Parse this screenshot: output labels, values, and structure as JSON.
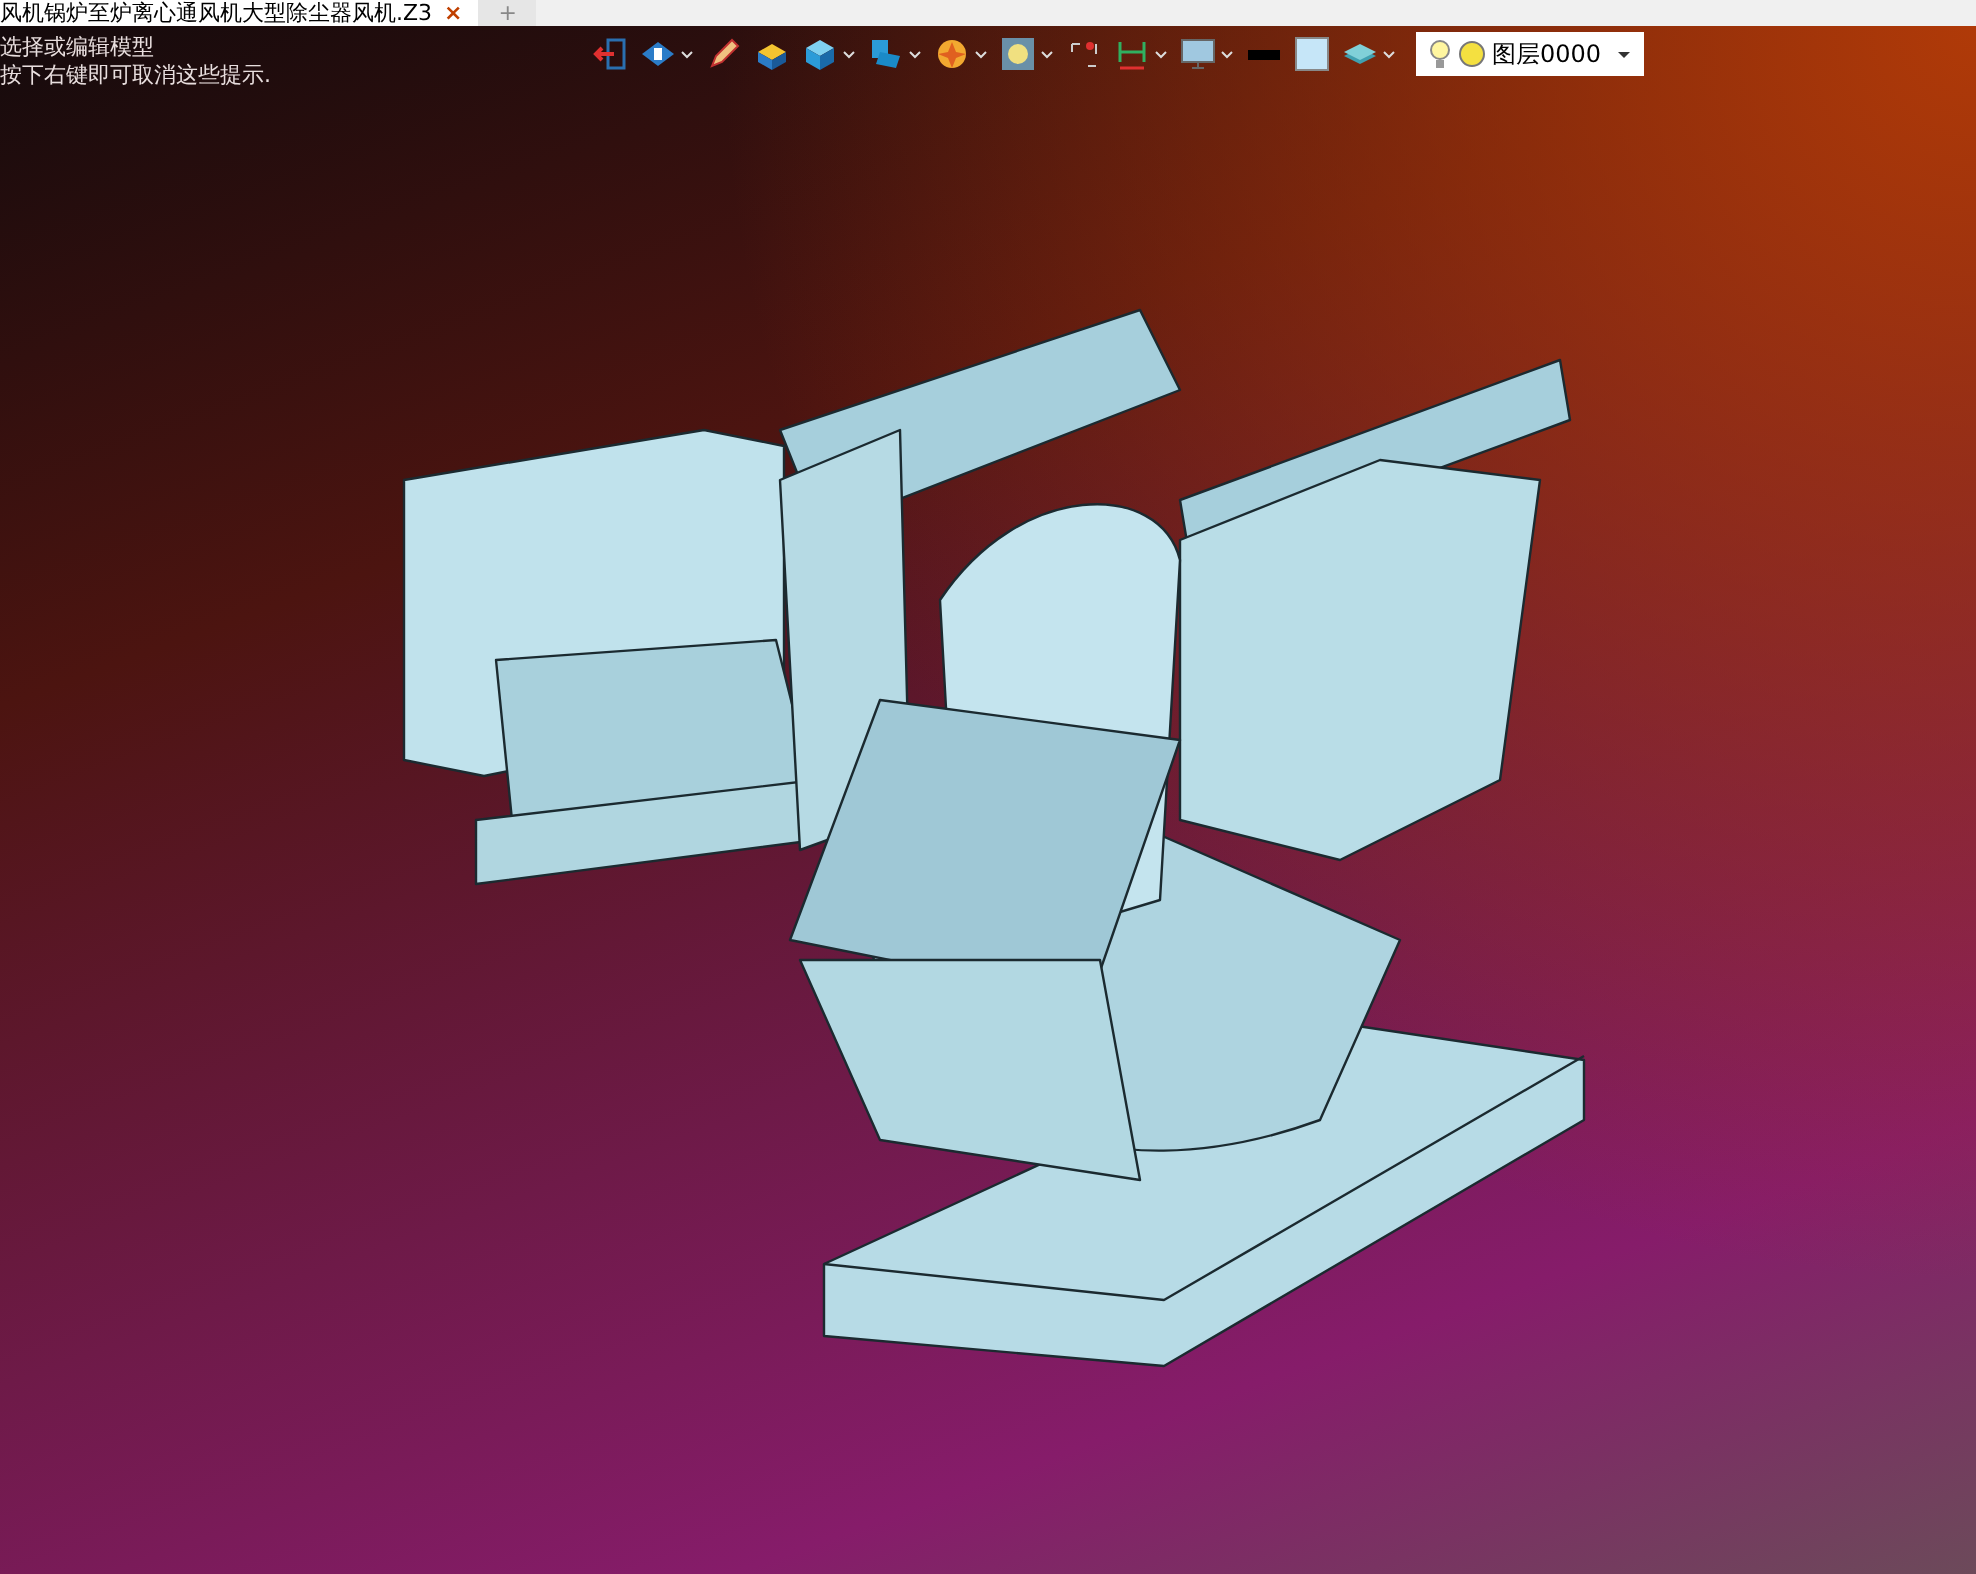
{
  "tabs": [
    {
      "label": "风机锅炉至炉离心通风机大型除尘器风机.Z3",
      "close": "×",
      "selected": true
    },
    {
      "label": "+",
      "selected": false
    }
  ],
  "hints": [
    "选择或编辑模型",
    "按下右键即可取消这些提示."
  ],
  "toolbar": [
    {
      "kind": "exit",
      "menu": false
    },
    {
      "kind": "view",
      "menu": true
    },
    {
      "kind": "pen",
      "menu": false
    },
    {
      "kind": "shade",
      "menu": false
    },
    {
      "kind": "cube",
      "menu": true
    },
    {
      "kind": "cubeview",
      "menu": true
    },
    {
      "kind": "star",
      "menu": true
    },
    {
      "kind": "zoom",
      "menu": true
    },
    {
      "kind": "select",
      "menu": false
    },
    {
      "kind": "dimension",
      "menu": true
    },
    {
      "kind": "monitor",
      "menu": true
    },
    {
      "kind": "line",
      "menu": false
    },
    {
      "kind": "swatch",
      "menu": false
    },
    {
      "kind": "layers",
      "menu": true
    }
  ],
  "layer": {
    "value": "图层0000",
    "visible": true
  }
}
